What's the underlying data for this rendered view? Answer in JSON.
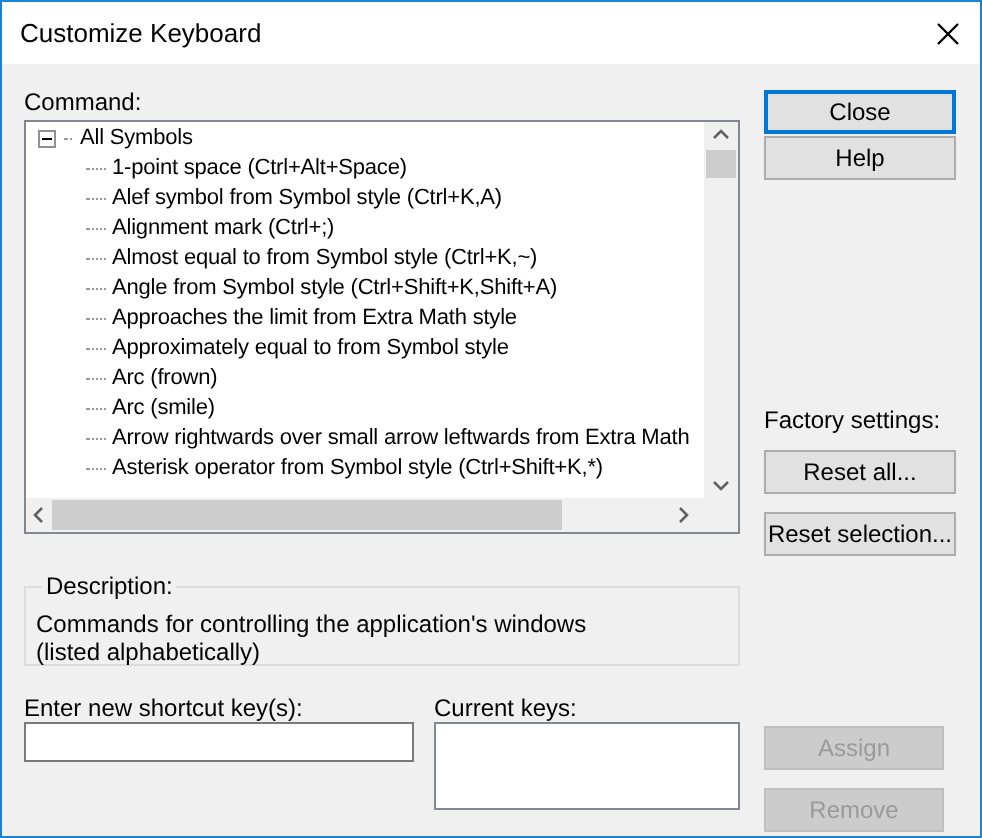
{
  "window": {
    "title": "Customize Keyboard"
  },
  "command": {
    "label": "Command:",
    "tree": [
      {
        "label": "All Symbols",
        "expanded": true,
        "children": [
          {
            "label": "1-point space (Ctrl+Alt+Space)"
          },
          {
            "label": "Alef symbol from Symbol style (Ctrl+K,A)"
          },
          {
            "label": "Alignment mark (Ctrl+;)"
          },
          {
            "label": "Almost equal to from Symbol style (Ctrl+K,~)"
          },
          {
            "label": "Angle from Symbol style (Ctrl+Shift+K,Shift+A)"
          },
          {
            "label": "Approaches the limit from Extra Math style"
          },
          {
            "label": "Approximately equal to from Symbol style"
          },
          {
            "label": "Arc (frown)"
          },
          {
            "label": "Arc (smile)"
          },
          {
            "label": "Arrow rightwards over small arrow leftwards from Extra Math"
          },
          {
            "label": "Asterisk operator from Symbol style (Ctrl+Shift+K,*)"
          }
        ]
      }
    ]
  },
  "buttons": [
    {
      "label": "Close",
      "default": true
    },
    {
      "label": "Help",
      "default": false
    }
  ],
  "factory": {
    "label": "Factory settings:",
    "buttons": [
      {
        "label": "Reset all..."
      },
      {
        "label": "Reset selection..."
      }
    ]
  },
  "description": {
    "label": "Description:",
    "text": "Commands for controlling the application's windows  (listed alphabetically)"
  },
  "new_shortcut": {
    "label": "Enter new shortcut key(s):"
  },
  "current_keys": {
    "label": "Current keys:"
  },
  "actions": [
    {
      "label": "Assign",
      "disabled": true
    },
    {
      "label": "Remove",
      "disabled": true
    }
  ]
}
